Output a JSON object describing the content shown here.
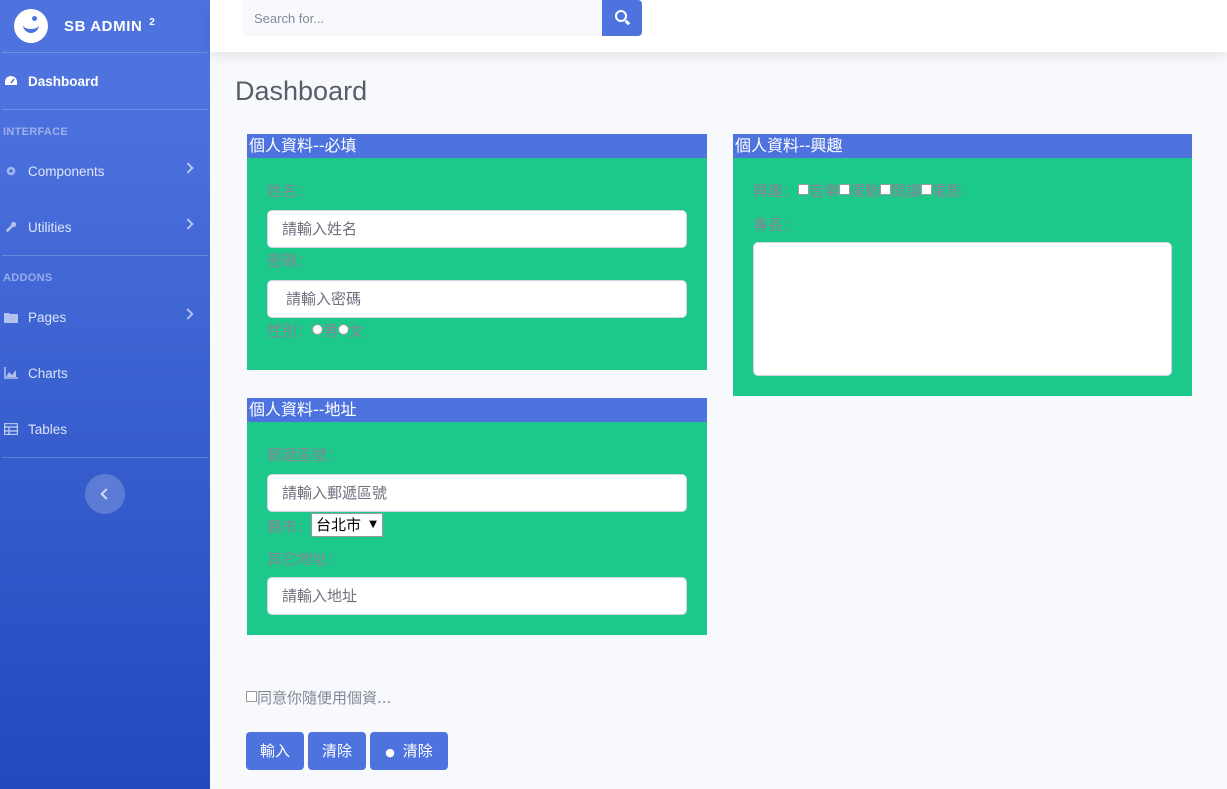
{
  "brand": {
    "name": "SB ADMIN",
    "version": "2"
  },
  "sidebar": {
    "dashboard": "Dashboard",
    "heading_interface": "INTERFACE",
    "components": "Components",
    "utilities": "Utilities",
    "heading_addons": "ADDONS",
    "pages": "Pages",
    "charts": "Charts",
    "tables": "Tables"
  },
  "search": {
    "placeholder": "Search for..."
  },
  "page_title": "Dashboard",
  "required_card": {
    "header": "個人資料--必填",
    "name_label": "姓名：",
    "name_placeholder": "請輸入姓名",
    "password_label": "密碼：",
    "password_placeholder": "請輸入密碼",
    "gender_label": "性別：",
    "male": "男",
    "female": "女"
  },
  "address_card": {
    "header": "個人資料--地址",
    "zip_label": "郵遞區號：",
    "zip_placeholder": "請輸入郵遞區號",
    "city_label": "縣市：",
    "city_value": "台北市",
    "other_label": "其它地址：",
    "address_placeholder": "請輸入地址"
  },
  "interest_card": {
    "header": "個人資料--興趣",
    "interest_label": "興趣：",
    "options": [
      "音樂",
      "運動",
      "閱讀",
      "電影"
    ],
    "specialty_label": "專長："
  },
  "agree_text": "同意你隨便用個資...",
  "buttons": {
    "submit": "輸入",
    "clear": "清除",
    "clear2": "清除"
  },
  "colors": {
    "primary": "#4e73df",
    "card_bg": "#1cc88a",
    "label": "#858796"
  }
}
